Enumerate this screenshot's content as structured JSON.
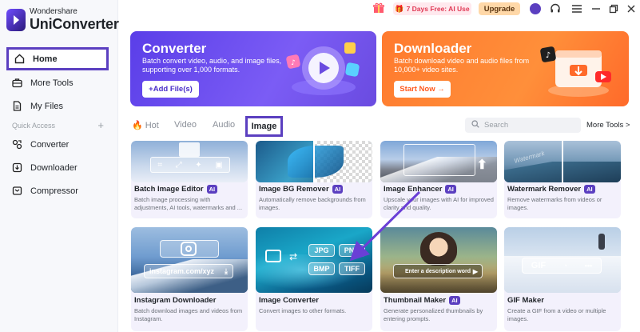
{
  "app": {
    "brand": "Wondershare",
    "product": "UniConverter"
  },
  "sidebar": {
    "items": [
      {
        "label": "Home",
        "icon": "home-icon"
      },
      {
        "label": "More Tools",
        "icon": "toolbox-icon"
      },
      {
        "label": "My Files",
        "icon": "file-icon"
      }
    ],
    "quick_access_label": "Quick Access",
    "quick_items": [
      {
        "label": "Converter",
        "icon": "converter-icon"
      },
      {
        "label": "Downloader",
        "icon": "download-icon"
      },
      {
        "label": "Compressor",
        "icon": "compress-icon"
      }
    ]
  },
  "titlebar": {
    "promo": "7 Days Free: AI Use",
    "upgrade": "Upgrade"
  },
  "banners": {
    "converter": {
      "title": "Converter",
      "desc": "Batch convert video, audio, and image files, supporting over 1,000 formats.",
      "button": "+Add File(s)"
    },
    "downloader": {
      "title": "Downloader",
      "desc": "Batch download video and audio files from 10,000+ video sites.",
      "button": "Start Now →"
    }
  },
  "tabs": {
    "hot": "Hot",
    "video": "Video",
    "audio": "Audio",
    "image": "Image"
  },
  "search": {
    "placeholder": "Search"
  },
  "more_tools_link": "More Tools >",
  "ai_badge": "AI",
  "cards": [
    {
      "title": "Batch Image Editor",
      "ai": true,
      "desc": "Batch image processing with adjustments, AI tools, watermarks and ..."
    },
    {
      "title": "Image BG Remover",
      "ai": true,
      "desc": "Automatically remove backgrounds from images."
    },
    {
      "title": "Image Enhancer",
      "ai": true,
      "desc": "Upscale your images with AI for improved clarity and quality."
    },
    {
      "title": "Watermark Remover",
      "ai": true,
      "desc": "Remove watermarks from videos or images."
    },
    {
      "title": "Instagram Downloader",
      "ai": false,
      "desc": "Batch download images and videos from Instagram."
    },
    {
      "title": "Image Converter",
      "ai": false,
      "desc": "Convert images to other formats."
    },
    {
      "title": "Thumbnail Maker",
      "ai": true,
      "desc": "Generate personalized thumbnails by entering prompts."
    },
    {
      "title": "GIF Maker",
      "ai": false,
      "desc": "Create a GIF from a video or multiple images."
    }
  ],
  "thumb_text": {
    "instagram_url": "instagram.com/xyz",
    "formats": [
      "JPG",
      "PNG",
      "BMP",
      "TIFF"
    ],
    "prompt_placeholder": "Enter a description word",
    "gif_label": "GIF"
  },
  "colors": {
    "accent": "#5b3fc0",
    "converter_banner": "#6a4be0",
    "downloader_banner": "#ff7a2e",
    "ai_badge": "#5b3fc0",
    "annotation_arrow": "#6a3fd6"
  }
}
